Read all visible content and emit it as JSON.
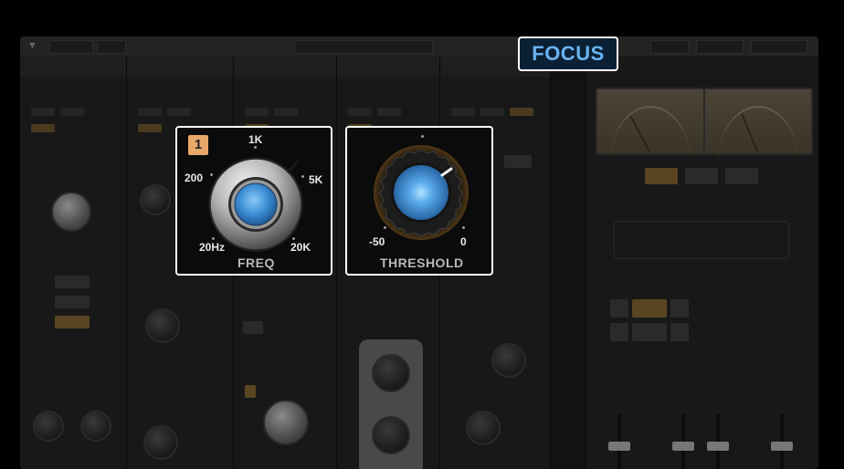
{
  "focus_badge": {
    "label": "FOCUS",
    "color": "#6ab3f0"
  },
  "freq_panel": {
    "badge": "1",
    "labels": {
      "top": "1K",
      "left": "200",
      "right": "5K",
      "bottom_left": "20Hz",
      "bottom_right": "20K"
    },
    "caption": "FREQ",
    "accent": "#e8a86a",
    "knob_color": "#4a9be0"
  },
  "threshold_panel": {
    "labels": {
      "min": "-50",
      "max": "0"
    },
    "caption": "THRESHOLD",
    "knob_color": "#4a9be0"
  }
}
